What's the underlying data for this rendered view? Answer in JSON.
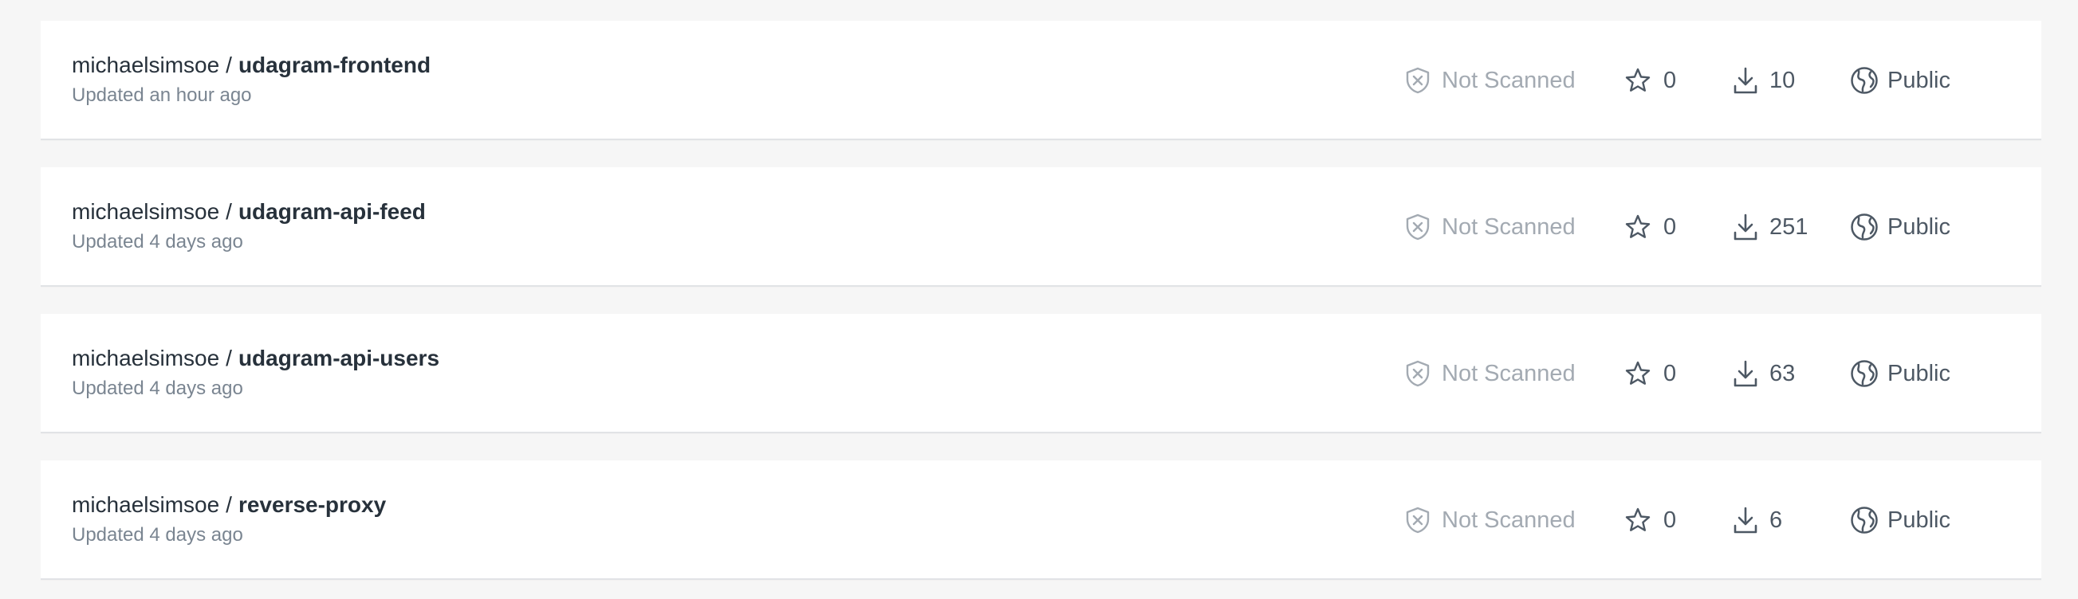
{
  "repositories": [
    {
      "namespace": "michaelsimsoe",
      "separator": "/",
      "name": "udagram-frontend",
      "updated": "Updated an hour ago",
      "scan_status": "Not Scanned",
      "stars": "0",
      "pulls": "10",
      "visibility": "Public"
    },
    {
      "namespace": "michaelsimsoe",
      "separator": "/",
      "name": "udagram-api-feed",
      "updated": "Updated 4 days ago",
      "scan_status": "Not Scanned",
      "stars": "0",
      "pulls": "251",
      "visibility": "Public"
    },
    {
      "namespace": "michaelsimsoe",
      "separator": "/",
      "name": "udagram-api-users",
      "updated": "Updated 4 days ago",
      "scan_status": "Not Scanned",
      "stars": "0",
      "pulls": "63",
      "visibility": "Public"
    },
    {
      "namespace": "michaelsimsoe",
      "separator": "/",
      "name": "reverse-proxy",
      "updated": "Updated 4 days ago",
      "scan_status": "Not Scanned",
      "stars": "0",
      "pulls": "6",
      "visibility": "Public"
    }
  ],
  "icons": {
    "scan": "shield-x-icon",
    "stars": "star-icon",
    "pulls": "download-icon",
    "visibility": "globe-icon"
  },
  "colors": {
    "page_background": "#f6f6f6",
    "card_background": "#ffffff",
    "title_text": "#27313b",
    "muted_text": "#7a8591",
    "scan_text": "#a3aab2",
    "meta_text": "#4d5864"
  }
}
